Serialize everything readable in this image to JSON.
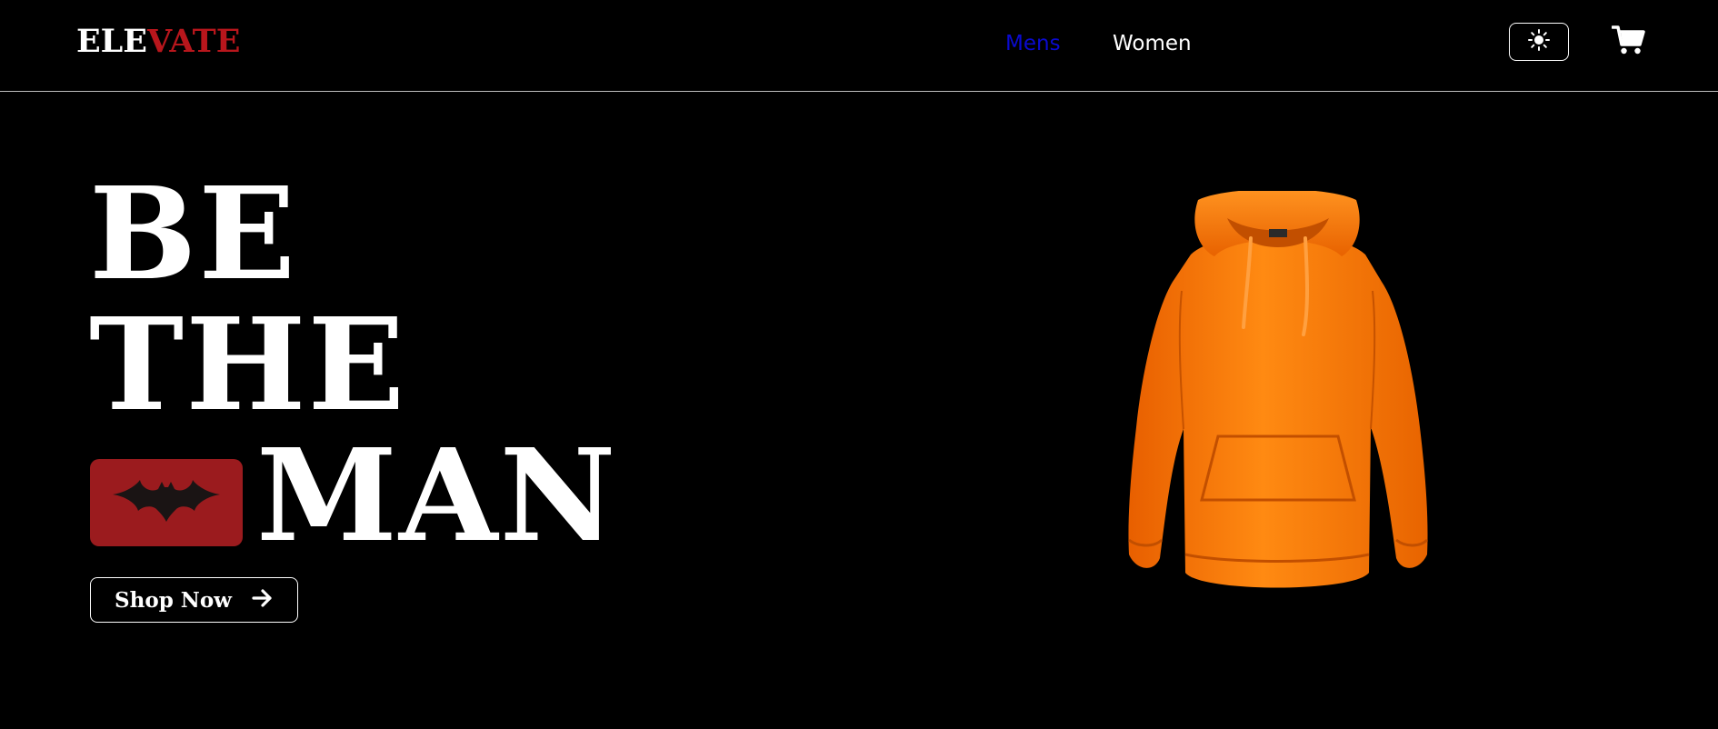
{
  "brand": {
    "logo_part1": "ELE",
    "logo_part2": "VATE",
    "logo_color": "#ffffff",
    "accent_color": "#b8161c"
  },
  "nav": {
    "items": [
      {
        "label": "Mens",
        "color": "#0a0ad0",
        "active": true
      },
      {
        "label": "Women",
        "color": "#ffffff",
        "active": false
      }
    ],
    "theme_toggle_icon": "sun-icon",
    "cart_icon": "cart-icon"
  },
  "hero": {
    "line1": "BE",
    "line2": "THE",
    "line3": "MAN",
    "badge_icon": "bat-logo-icon",
    "badge_color": "#9b1b1e",
    "cta_label": "Shop Now",
    "cta_icon": "arrow-right-icon",
    "product_image": "orange-hoodie",
    "product_color": "#ff7a00"
  }
}
